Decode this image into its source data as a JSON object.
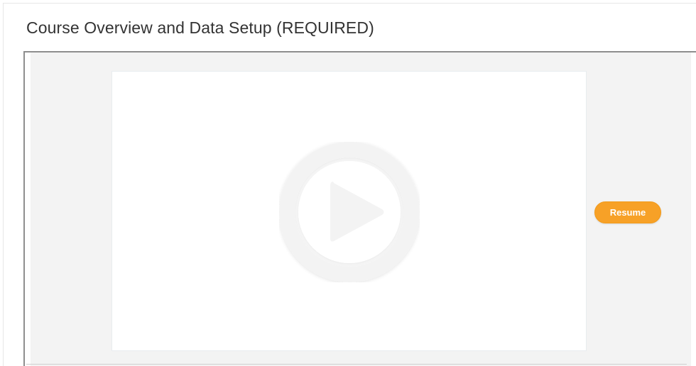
{
  "page": {
    "title": "Course Overview and Data Setup (REQUIRED)"
  },
  "player": {
    "resume_label": "Resume",
    "play_icon": "play-circle-icon",
    "accent_color": "#f7a127"
  }
}
